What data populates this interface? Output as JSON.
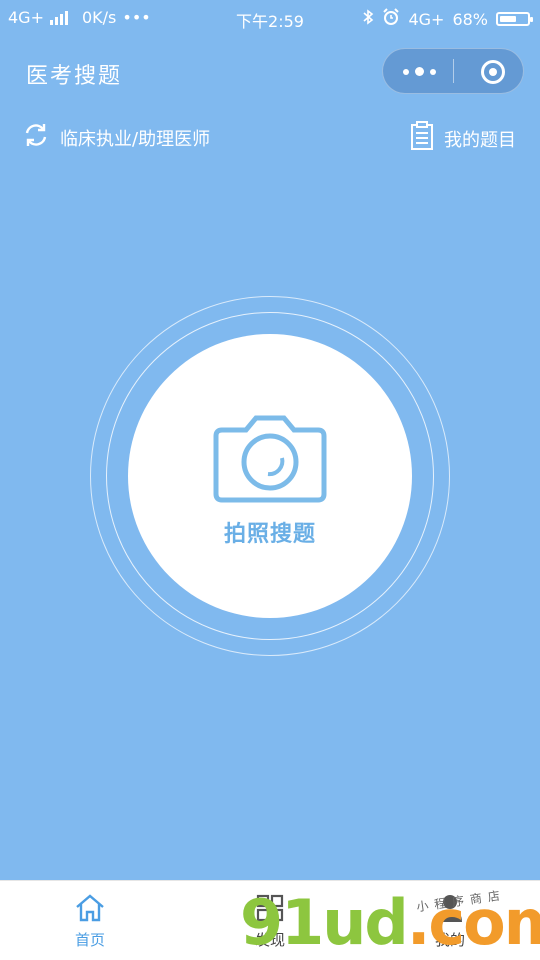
{
  "status": {
    "network": "4G+",
    "speed": "0K/s",
    "more": "•••",
    "time": "下午2:59",
    "network2": "4G+",
    "battery": "68%",
    "battery_level": 0.68
  },
  "header": {
    "title": "医考搜题"
  },
  "subbar": {
    "category": "临床执业/助理医师",
    "my_questions": "我的题目"
  },
  "main": {
    "shoot_label": "拍照搜题"
  },
  "tabs": [
    {
      "label": "首页",
      "icon": "home-icon"
    },
    {
      "label": "发现",
      "icon": "grid-icon"
    },
    {
      "label": "我的",
      "icon": "user-icon"
    }
  ],
  "watermark": {
    "brand_green": "91ud",
    "brand_orange": ".com",
    "subtitle": "小程序商店"
  },
  "colors": {
    "background": "#80b9ef",
    "accent": "#4a9de3",
    "camera": "#7cbbe9"
  }
}
